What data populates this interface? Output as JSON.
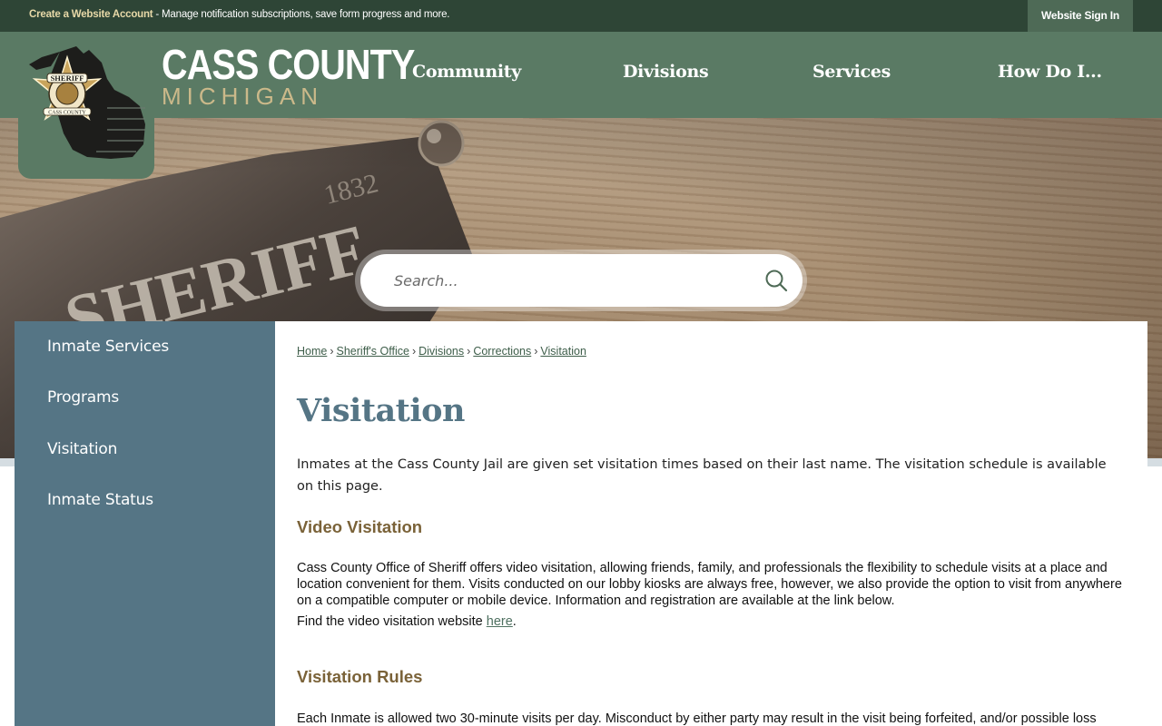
{
  "topbar": {
    "create_account_link": "Create a Website Account",
    "message": " - Manage notification subscriptions, save form progress and more.",
    "sign_in": "Website Sign In"
  },
  "header": {
    "logo_badge_text": "SHERIFF",
    "logo_badge_subtext": "CASS COUNTY",
    "site_name_line1": "CASS COUNTY",
    "site_name_line2": "MICHIGAN",
    "nav": [
      "Community",
      "Divisions",
      "Services",
      "How Do I..."
    ]
  },
  "search": {
    "placeholder": "Search..."
  },
  "sidebar": {
    "items": [
      "Inmate Services",
      "Programs",
      "Visitation",
      "Inmate Status"
    ]
  },
  "breadcrumb": [
    "Home",
    "Sheriff's Office",
    "Divisions",
    "Corrections",
    "Visitation"
  ],
  "page": {
    "title": "Visitation",
    "intro": "Inmates at the Cass County Jail are given set visitation times based on their last name. The visitation schedule is available on this page.",
    "section1_heading": "Video Visitation",
    "section1_text": "Cass County Office of Sheriff offers video visitation, allowing friends, family, and professionals the flexibility to schedule visits at a place and location convenient for them. Visits conducted on our lobby kiosks are always free, however, we also provide the option to visit from anywhere on a compatible computer or mobile device. Information and registration are available at the link below.",
    "section1_link_prefix": "Find the video visitation website ",
    "section1_link": "here",
    "section1_link_suffix": ".",
    "section2_heading": "Visitation Rules",
    "section2_text": "Each Inmate is allowed two 30-minute visits per day. Misconduct by either party may result in the visit being forfeited, and/or possible loss"
  },
  "colors": {
    "topbar_bg": "#2e4536",
    "header_bg": "#5a7a64",
    "sidebar_bg": "#557585",
    "title_color": "#557585",
    "heading_color": "#7a6238",
    "site_name_accent": "#cbb98a"
  }
}
